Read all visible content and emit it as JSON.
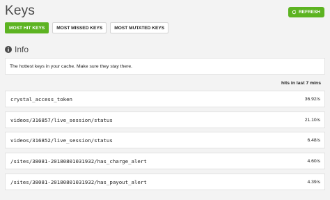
{
  "page": {
    "title": "Keys"
  },
  "toolbar": {
    "refresh_label": "REFRESH",
    "refresh_icon": "refresh-icon"
  },
  "tabs": [
    {
      "label": "MOST HIT KEYS",
      "active": true
    },
    {
      "label": "MOST MISSED KEYS",
      "active": false
    },
    {
      "label": "MOST MUTATED KEYS",
      "active": false
    }
  ],
  "info": {
    "icon": "info-icon",
    "heading": "Info",
    "text": "The hottest keys in your cache. Make sure they stay there."
  },
  "table": {
    "column_header": "hits in last 7 mins",
    "rows": [
      {
        "key": "crystal_access_token",
        "value": "36.92/s"
      },
      {
        "key": "videos/316857/live_session/status",
        "value": "21.10/s"
      },
      {
        "key": "videos/316852/live_session/status",
        "value": "6.48/s"
      },
      {
        "key": "/sites/38081-20180801031932/has_charge_alert",
        "value": "4.60/s"
      },
      {
        "key": "/sites/38081-20180801031932/has_payout_alert",
        "value": "4.39/s"
      }
    ]
  },
  "colors": {
    "accent": "#5cb321",
    "background": "#f3f3f3"
  }
}
